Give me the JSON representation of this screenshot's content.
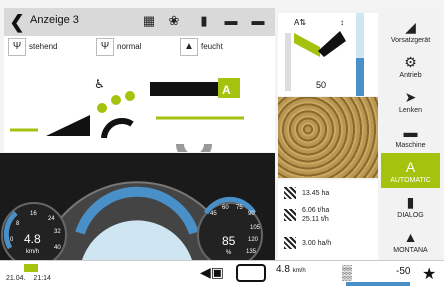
{
  "header": {
    "back_icon": "chevron-left-icon",
    "title": "Anzeige 3"
  },
  "toolbar_icons": [
    "calculator-icon",
    "grain-icon",
    "chart-icon",
    "harvester-icon",
    "harvester-icon"
  ],
  "modes": [
    {
      "label": "stehend",
      "icon": "crop-standing-icon"
    },
    {
      "label": "normal",
      "icon": "crop-normal-icon"
    },
    {
      "label": "feucht",
      "icon": "crop-wet-icon"
    }
  ],
  "header_mark": "A",
  "sensor": {
    "value": "50"
  },
  "stats": [
    {
      "line1": "13.45 ha",
      "line2": ""
    },
    {
      "line1": "6.06 t/ha",
      "line2": "25.11 t/h"
    },
    {
      "line1": "3.00 ha/h",
      "line2": ""
    }
  ],
  "side_menu": [
    {
      "label": "Vorsatzgerät",
      "icon": "header-icon"
    },
    {
      "label": "Antrieb",
      "icon": "drive-icon"
    },
    {
      "label": "Lenken",
      "icon": "steering-icon"
    },
    {
      "label": "Maschine",
      "icon": "machine-icon"
    },
    {
      "label": "AUTOMATIC",
      "icon": "automatic-icon",
      "active": true,
      "mark": "A"
    },
    {
      "label": "DIALOG",
      "icon": "dialog-icon"
    },
    {
      "label": "MONTANA",
      "icon": "montana-icon"
    }
  ],
  "gauges": {
    "speed": {
      "value": "4.8",
      "unit": "km/h",
      "ticks": [
        "8",
        "16",
        "24",
        "32",
        "40",
        "0"
      ]
    },
    "engine": {
      "value": "85",
      "unit": "%",
      "ticks": [
        "45",
        "60",
        "75",
        "90",
        "105",
        "120",
        "135"
      ]
    }
  },
  "status": {
    "date": "21.04.",
    "time": "21:14",
    "speed_value": "4.8",
    "speed_unit": "km/h",
    "offset_value": "-50"
  },
  "colors": {
    "accent": "#a5c30e",
    "gauge_blue": "#4a90c8",
    "dark": "#1a1a1a"
  }
}
